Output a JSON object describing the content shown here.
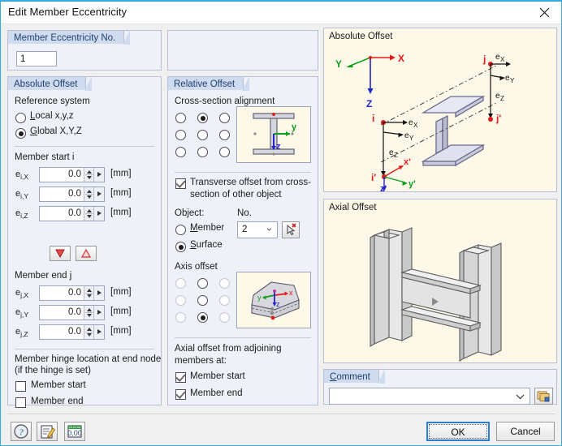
{
  "window": {
    "title": "Edit Member Eccentricity",
    "close_label": "close-icon"
  },
  "eccentricity_no": {
    "header": "Member Eccentricity No.",
    "value": "1"
  },
  "absolute_offset": {
    "header": "Absolute Offset",
    "reference_system_label": "Reference system",
    "reference_options": [
      {
        "label": "Local x,y,z",
        "selected": false
      },
      {
        "label": "Global X,Y,Z",
        "selected": true
      }
    ],
    "member_start_label": "Member start i",
    "member_start_fields": [
      {
        "label": "ei,X",
        "value": "0.0",
        "unit": "[mm]"
      },
      {
        "label": "ei,Y",
        "value": "0.0",
        "unit": "[mm]"
      },
      {
        "label": "ei,Z",
        "value": "0.0",
        "unit": "[mm]"
      }
    ],
    "member_end_label": "Member end j",
    "member_end_fields": [
      {
        "label": "ej,X",
        "value": "0.0",
        "unit": "[mm]"
      },
      {
        "label": "ej,Y",
        "value": "0.0",
        "unit": "[mm]"
      },
      {
        "label": "ej,Z",
        "value": "0.0",
        "unit": "[mm]"
      }
    ],
    "arrow_down_button": "transfer-down-button",
    "arrow_up_button": "transfer-up-button",
    "hinge_label_line1": "Member hinge location at end node",
    "hinge_label_line2": "(if the hinge is set)",
    "hinge_options": [
      {
        "label": "Member start",
        "checked": false
      },
      {
        "label": "Member end",
        "checked": false
      }
    ]
  },
  "relative_offset": {
    "header": "Relative Offset",
    "cross_section_alignment_label": "Cross-section alignment",
    "alignment_grid": [
      [
        false,
        true,
        false
      ],
      [
        false,
        false,
        false
      ],
      [
        false,
        false,
        false
      ]
    ],
    "transverse_offset": {
      "checked": true,
      "line1": "Transverse offset from cross-",
      "line2": "section of other object"
    },
    "object_label": "Object:",
    "no_label": "No.",
    "object_options": [
      {
        "label": "Member",
        "selected": false
      },
      {
        "label": "Surface",
        "selected": true
      }
    ],
    "object_no_value": "2",
    "pick_button": "pick-object-button",
    "axis_offset_label": "Axis offset",
    "axis_offset_grid": [
      [
        false,
        false,
        false
      ],
      [
        false,
        false,
        false
      ],
      [
        false,
        true,
        false
      ]
    ],
    "axis_offset_enabled_column": 1,
    "axial_offset_label_line1": "Axial offset from adjoining",
    "axial_offset_label_line2": "members at:",
    "axial_offset_options": [
      {
        "label": "Member start",
        "checked": true
      },
      {
        "label": "Member end",
        "checked": true
      }
    ]
  },
  "graphics": {
    "absolute_offset_title": "Absolute Offset",
    "axial_offset_title": "Axial Offset",
    "absolute_labels": {
      "global_x": "X",
      "global_y": "Y",
      "global_z": "Z",
      "local_x": "x'",
      "local_y": "y'",
      "local_z": "z'",
      "node_i": "i",
      "node_i_prime": "i'",
      "node_j": "j",
      "node_j_prime": "j'",
      "e_x": "e",
      "e_y": "e",
      "e_z": "e",
      "sub_x": "X",
      "sub_y": "Y",
      "sub_z": "Z"
    },
    "thumb_section_labels": {
      "y": "y",
      "z": "z"
    },
    "thumb_surface_labels": {
      "x": "x",
      "y": "y",
      "z": "z"
    }
  },
  "comment": {
    "header": "Comment",
    "value": "",
    "pick_button": "comment-library-button"
  },
  "footer": {
    "help_button": "help-icon",
    "note_button": "edit-note-icon",
    "units_button": "units-decimals-icon",
    "ok_label": "OK",
    "cancel_label": "Cancel"
  },
  "colors": {
    "accent": "#35a8e6",
    "group_header": "#cfdcef",
    "group_header_text": "#1f3f6e",
    "panel_bg": "#eef1f7",
    "picture_bg": "#fdf8e8",
    "axis_x": "#e01b1b",
    "axis_y": "#0aa01e",
    "axis_z": "#2424cc"
  }
}
